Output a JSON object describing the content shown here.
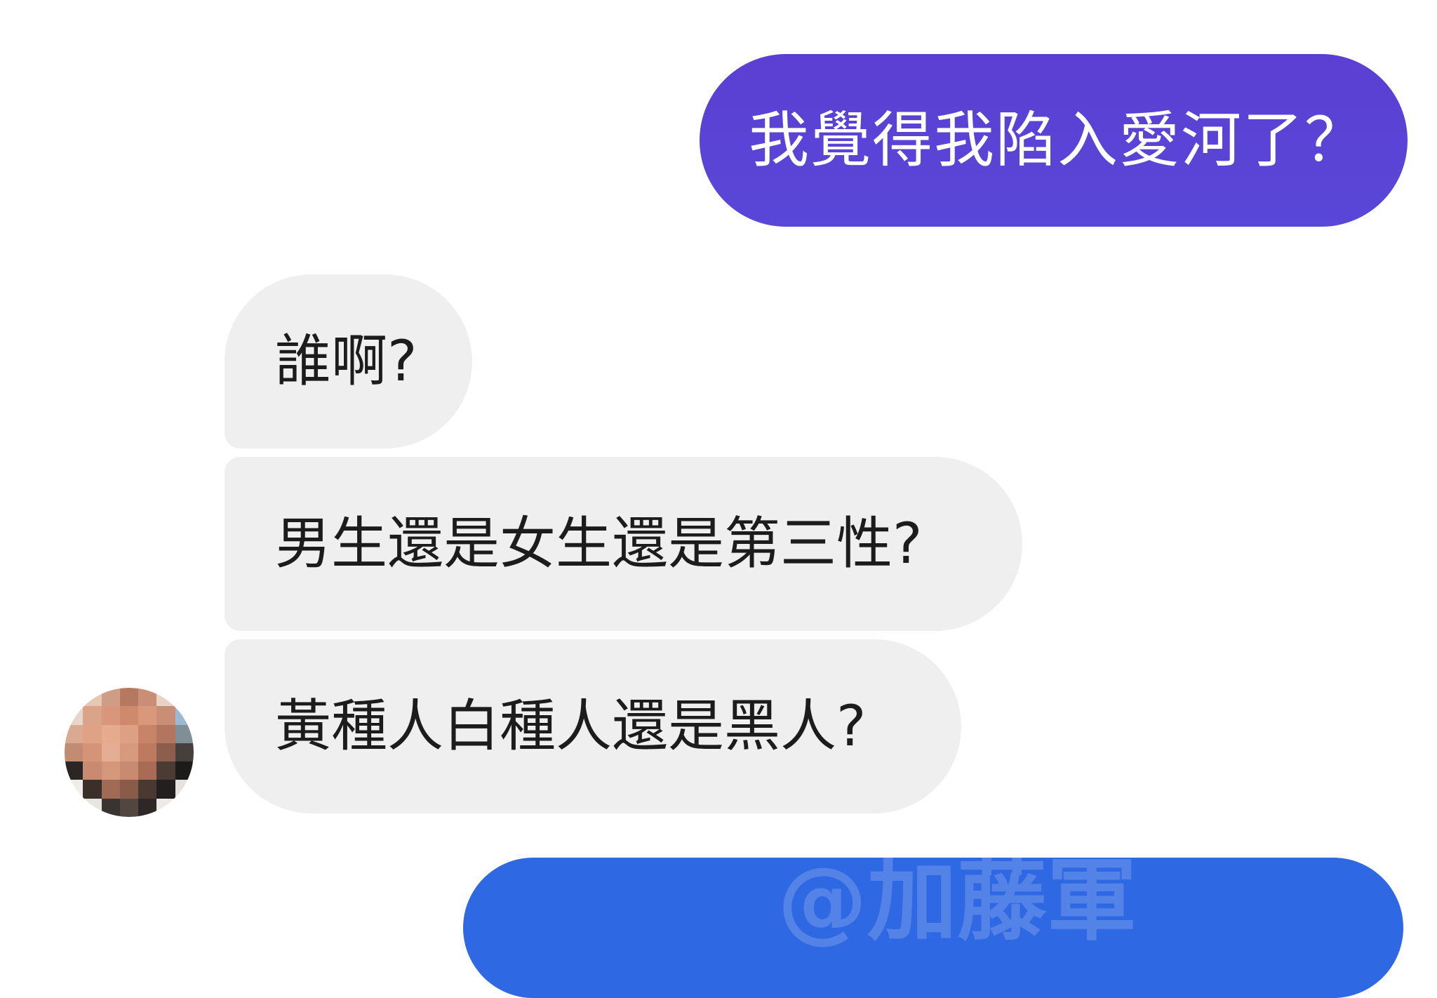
{
  "messages": {
    "outgoing_1": "我覺得我陷入愛河了？",
    "incoming_1": "誰啊?",
    "incoming_2": "男生還是女生還是第三性?",
    "incoming_3": "黃種人白種人還是黑人?"
  },
  "watermark": "@加藤軍",
  "colors": {
    "outgoing_bubble": "#5a44d6",
    "incoming_bubble": "#efefef",
    "outgoing_bubble_blue": "#2f68e3"
  },
  "avatar": {
    "icon": "pixelated-avatar"
  }
}
